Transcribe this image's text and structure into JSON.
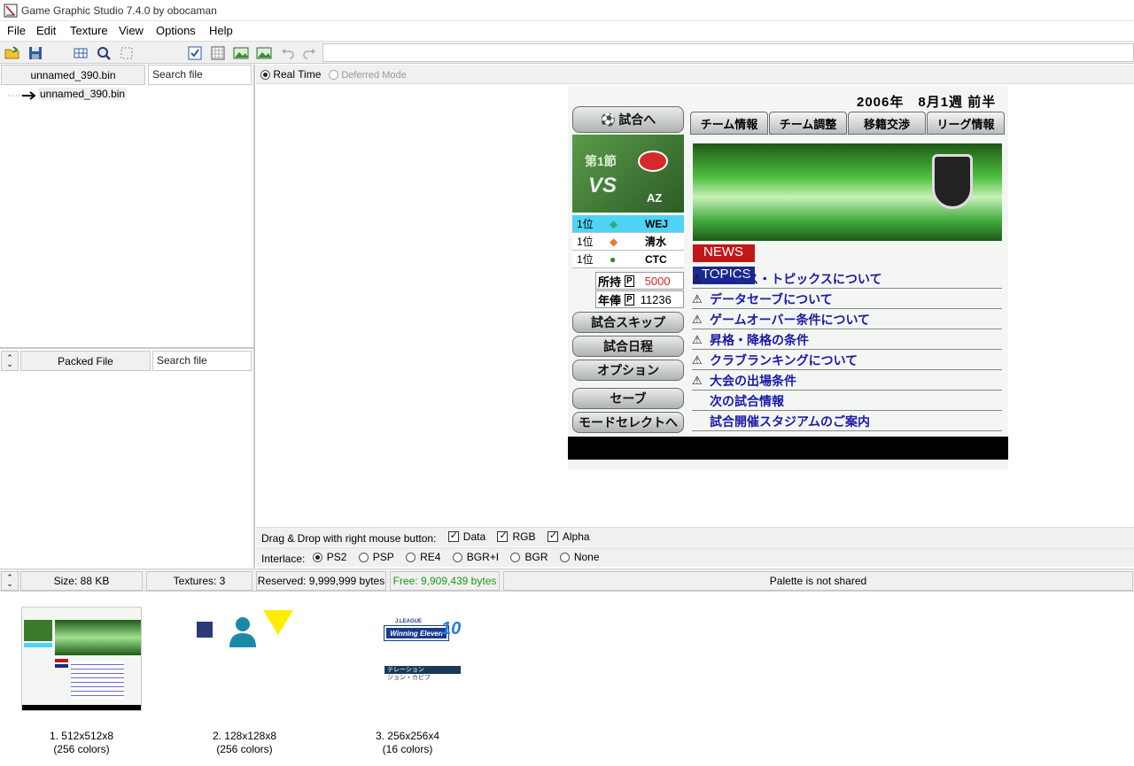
{
  "window": {
    "title": "Game Graphic Studio 7.4.0 by obocaman"
  },
  "menu": [
    "File",
    "Edit",
    "Texture",
    "View",
    "Options",
    "Help"
  ],
  "left_top": {
    "file_tab": "unnamed_390.bin",
    "search_placeholder": "Search file",
    "tree_item": "unnamed_390.bin"
  },
  "left_bottom": {
    "tab": "Packed File",
    "search_placeholder": "Search file"
  },
  "render_mode": {
    "realtime": "Real Time",
    "deferred": "Deferred Mode"
  },
  "dragdrop": {
    "label": "Drag & Drop with right mouse button:",
    "data": "Data",
    "rgb": "RGB",
    "alpha": "Alpha"
  },
  "interlace": {
    "label": "Interlace:",
    "options": [
      "PS2",
      "PSP",
      "RE4",
      "BGR+I",
      "BGR",
      "None"
    ]
  },
  "status": {
    "size": "Size: 88 KB",
    "textures": "Textures: 3",
    "reserved": "Reserved: 9,999,999 bytes",
    "free": "Free: 9,909,439 bytes",
    "palette": "Palette is not shared"
  },
  "thumbnails": [
    {
      "line1": "1. 512x512x8",
      "line2": "(256 colors)"
    },
    {
      "line1": "2. 128x128x8",
      "line2": "(256 colors)"
    },
    {
      "line1": "3. 256x256x4",
      "line2": "(16 colors)"
    }
  ],
  "game": {
    "date": "2006年　8月1週 前半",
    "to_match": "試合へ",
    "tabs": [
      "チーム情報",
      "チーム調整",
      "移籍交渉",
      "リーグ情報"
    ],
    "matchday": "第1節",
    "vs": "VS",
    "opponent": "AZ",
    "ranks": [
      {
        "pos": "1位",
        "team": "WEJ"
      },
      {
        "pos": "1位",
        "team": "清水"
      },
      {
        "pos": "1位",
        "team": "CTC"
      }
    ],
    "money_label": "所持",
    "money_value": "5000",
    "salary_label": "年俸",
    "salary_value": "11236",
    "p_badge": "P",
    "buttons": [
      "試合スキップ",
      "試合日程",
      "オプション",
      "セーブ",
      "モードセレクトへ"
    ],
    "news": "NEWS",
    "topics": "TOPICS",
    "topic_items": [
      "ニュース・トピックスについて",
      "データセーブについて",
      "ゲームオーバー条件について",
      "昇格・降格の条件",
      "クラブランキングについて",
      "大会の出場条件",
      "次の試合情報",
      "試合開催スタジアムのご案内"
    ]
  },
  "texture3": {
    "brand_top": "J.LEAGUE",
    "brand": "Winning Eleven",
    "number": "10",
    "line1": "テレーション",
    "line2": "ジョン・カビフ"
  },
  "colors": {
    "free_text": "#1a9a1a",
    "accent_cyan": "#4fd3f5",
    "topic_blue": "#1a1aa8",
    "banner_green": "#3fa83a",
    "yellow": "#ffee00"
  }
}
